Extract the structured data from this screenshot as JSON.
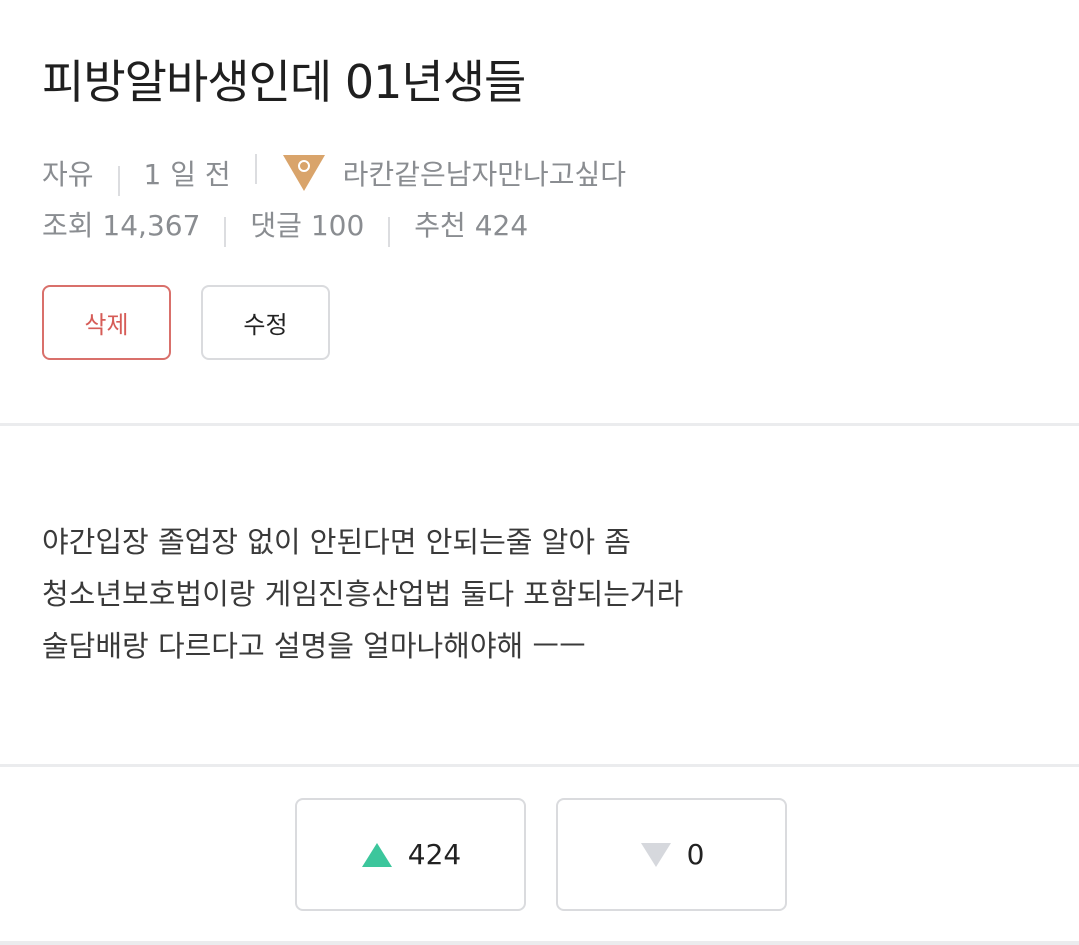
{
  "post": {
    "title": "피방알바생인데 01년생들",
    "category": "자유",
    "time": "1 일 전",
    "author": "라칸같은남자만나고싶다",
    "level_icon": "level-badge-icon",
    "stats": {
      "views": "조회 14,367",
      "comments": "댓글 100",
      "recommends": "추천 424"
    },
    "buttons": {
      "delete": "삭제",
      "edit": "수정"
    },
    "body_lines": [
      "야간입장 졸업장 없이 안된다면 안되는줄 알아 좀",
      "청소년보호법이랑 게임진흥산업법 둘다 포함되는거라",
      "술담배랑 다르다고 설명을 얼마나해야해 ㅡㅡ"
    ]
  },
  "votes": {
    "up": "424",
    "down": "0"
  },
  "colors": {
    "upvote": "#3cc69c",
    "downvote": "#d6d8dd",
    "delete_accent": "#d65c57",
    "badge": "#d9a46b"
  }
}
